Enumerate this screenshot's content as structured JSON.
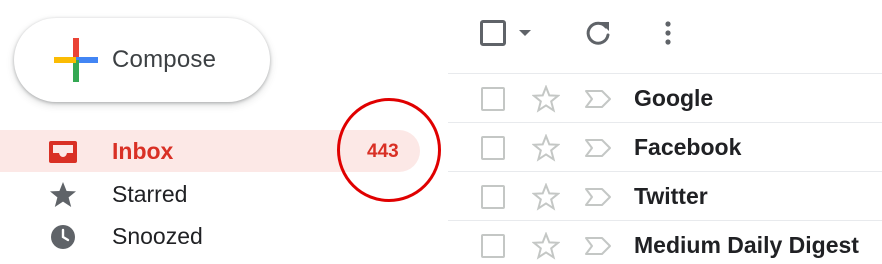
{
  "compose": {
    "label": "Compose",
    "icon": "plus-multicolor-icon"
  },
  "sidebar": {
    "items": [
      {
        "label": "Inbox",
        "count": "443",
        "icon": "inbox-icon",
        "active": true
      },
      {
        "label": "Starred",
        "icon": "star-icon"
      },
      {
        "label": "Snoozed",
        "icon": "clock-icon"
      }
    ]
  },
  "toolbar": {
    "icons": [
      "select-checkbox",
      "caret-down-icon",
      "refresh-icon",
      "more-vert-icon"
    ]
  },
  "mails": [
    {
      "sender": "Google"
    },
    {
      "sender": "Facebook"
    },
    {
      "sender": "Twitter"
    },
    {
      "sender": "Medium Daily Digest"
    }
  ],
  "colors": {
    "accent_red": "#d93025",
    "active_bg": "#fce8e6",
    "highlight_circle": "#e00000",
    "icon_gray": "#5f6368"
  }
}
